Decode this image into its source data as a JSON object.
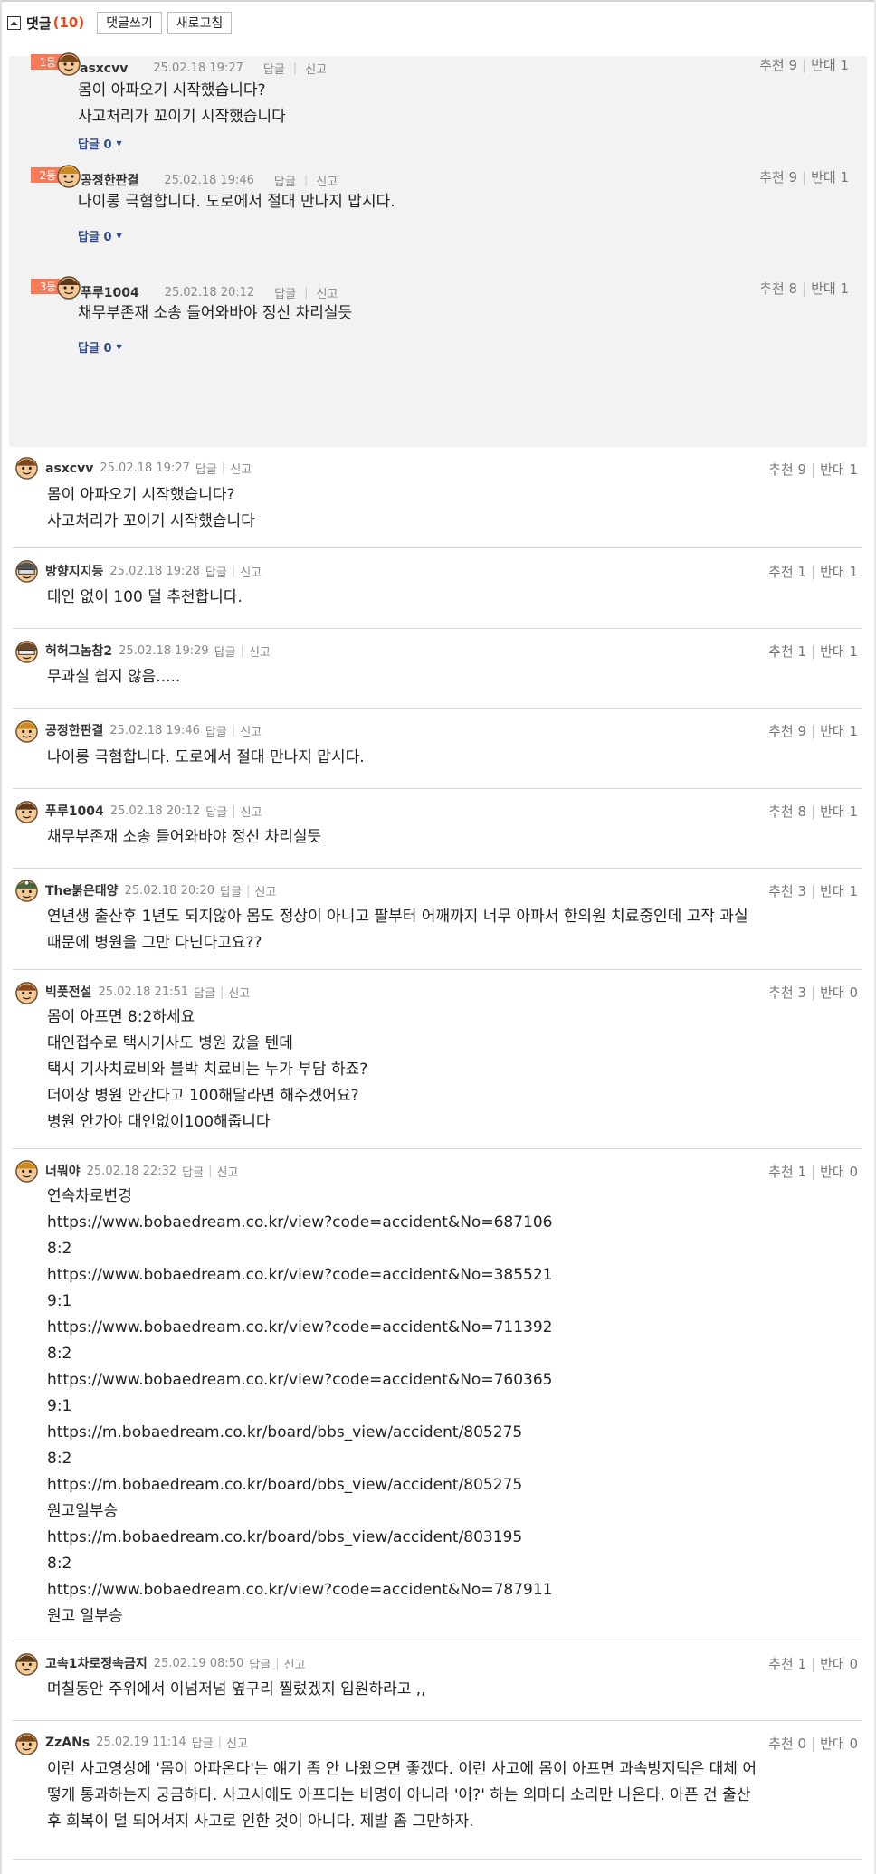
{
  "header": {
    "title": "댓글",
    "count": "(10)",
    "write_label": "댓글쓰기",
    "refresh_label": "새로고침"
  },
  "labels": {
    "reply": "답글",
    "report": "신고",
    "recommend": "추천",
    "oppose": "반대",
    "reply_count": "답글 0"
  },
  "best": [
    {
      "rank": "1등",
      "nick": "asxcvv",
      "date": "25.02.18 19:27",
      "up": "9",
      "down": "1",
      "text": "몸이 아파오기 시작했습니다?\n사고처리가 꼬이기 시작했습니다"
    },
    {
      "rank": "2등",
      "nick": "공정한판결",
      "date": "25.02.18 19:46",
      "up": "9",
      "down": "1",
      "text": "나이롱 극혐합니다. 도로에서 절대 만나지 맙시다."
    },
    {
      "rank": "3등",
      "nick": "푸루1004",
      "date": "25.02.18 20:12",
      "up": "8",
      "down": "1",
      "text": "채무부존재 소송 들어와바야 정신 차리실듯"
    }
  ],
  "comments": [
    {
      "nick": "asxcvv",
      "date": "25.02.18 19:27",
      "up": "9",
      "down": "1",
      "text": "몸이 아파오기 시작했습니다?\n사고처리가 꼬이기 시작했습니다"
    },
    {
      "nick": "방향지지등",
      "date": "25.02.18 19:28",
      "up": "1",
      "down": "1",
      "text": "대인 없이 100 덜 추천합니다."
    },
    {
      "nick": "허허그놈참2",
      "date": "25.02.18 19:29",
      "up": "1",
      "down": "1",
      "text": "무과실 쉽지 않음....."
    },
    {
      "nick": "공정한판결",
      "date": "25.02.18 19:46",
      "up": "9",
      "down": "1",
      "text": "나이롱 극혐합니다. 도로에서 절대 만나지 맙시다."
    },
    {
      "nick": "푸루1004",
      "date": "25.02.18 20:12",
      "up": "8",
      "down": "1",
      "text": "채무부존재 소송 들어와바야 정신 차리실듯"
    },
    {
      "nick": "The붉은태양",
      "date": "25.02.18 20:20",
      "up": "3",
      "down": "1",
      "text": "연년생 출산후 1년도 되지않아 몸도 정상이 아니고 팔부터 어깨까지 너무 아파서 한의원 치료중인데 고작 과실\n때문에 병원을 그만 다닌다고요??"
    },
    {
      "nick": "빅풋전설",
      "date": "25.02.18 21:51",
      "up": "3",
      "down": "0",
      "text": "몸이 아프면 8:2하세요\n대인접수로 택시기사도 병원 갔을 텐데\n택시 기사치료비와 블박 치료비는 누가 부담 하죠?\n더이상 병원 안간다고 100해달라면 해주겠어요?\n병원 안가야 대인없이100해줍니다"
    },
    {
      "nick": "너뭐야",
      "date": "25.02.18 22:32",
      "up": "1",
      "down": "0",
      "text": "연속차로변경\nhttps://www.bobaedream.co.kr/view?code=accident&No=687106\n8:2\nhttps://www.bobaedream.co.kr/view?code=accident&No=385521\n9:1\nhttps://www.bobaedream.co.kr/view?code=accident&No=711392\n8:2\nhttps://www.bobaedream.co.kr/view?code=accident&No=760365\n9:1\nhttps://m.bobaedream.co.kr/board/bbs_view/accident/805275\n8:2\nhttps://m.bobaedream.co.kr/board/bbs_view/accident/805275\n원고일부승\nhttps://m.bobaedream.co.kr/board/bbs_view/accident/803195\n8:2\nhttps://www.bobaedream.co.kr/view?code=accident&No=787911\n원고 일부승"
    },
    {
      "nick": "고속1차로정속금지",
      "date": "25.02.19 08:50",
      "up": "1",
      "down": "0",
      "text": "며칠동안 주위에서 이넘저넘 옆구리 찔렀겠지 입원하라고 ,,"
    },
    {
      "nick": "ZzANs",
      "date": "25.02.19 11:14",
      "up": "0",
      "down": "0",
      "text": "이런 사고영상에 '몸이 아파온다'는 얘기 좀 안 나왔으면 좋겠다. 이런 사고에 몸이 아프면 과속방지턱은 대체 어\n떻게 통과하는지 궁금하다. 사고시에도 아프다는 비명이 아니라 '어?' 하는 외마디 소리만 나온다. 아픈 건 출산\n후 회복이 덜 되어서지 사고로 인한 것이 아니다. 제발 좀 그만하자."
    }
  ]
}
